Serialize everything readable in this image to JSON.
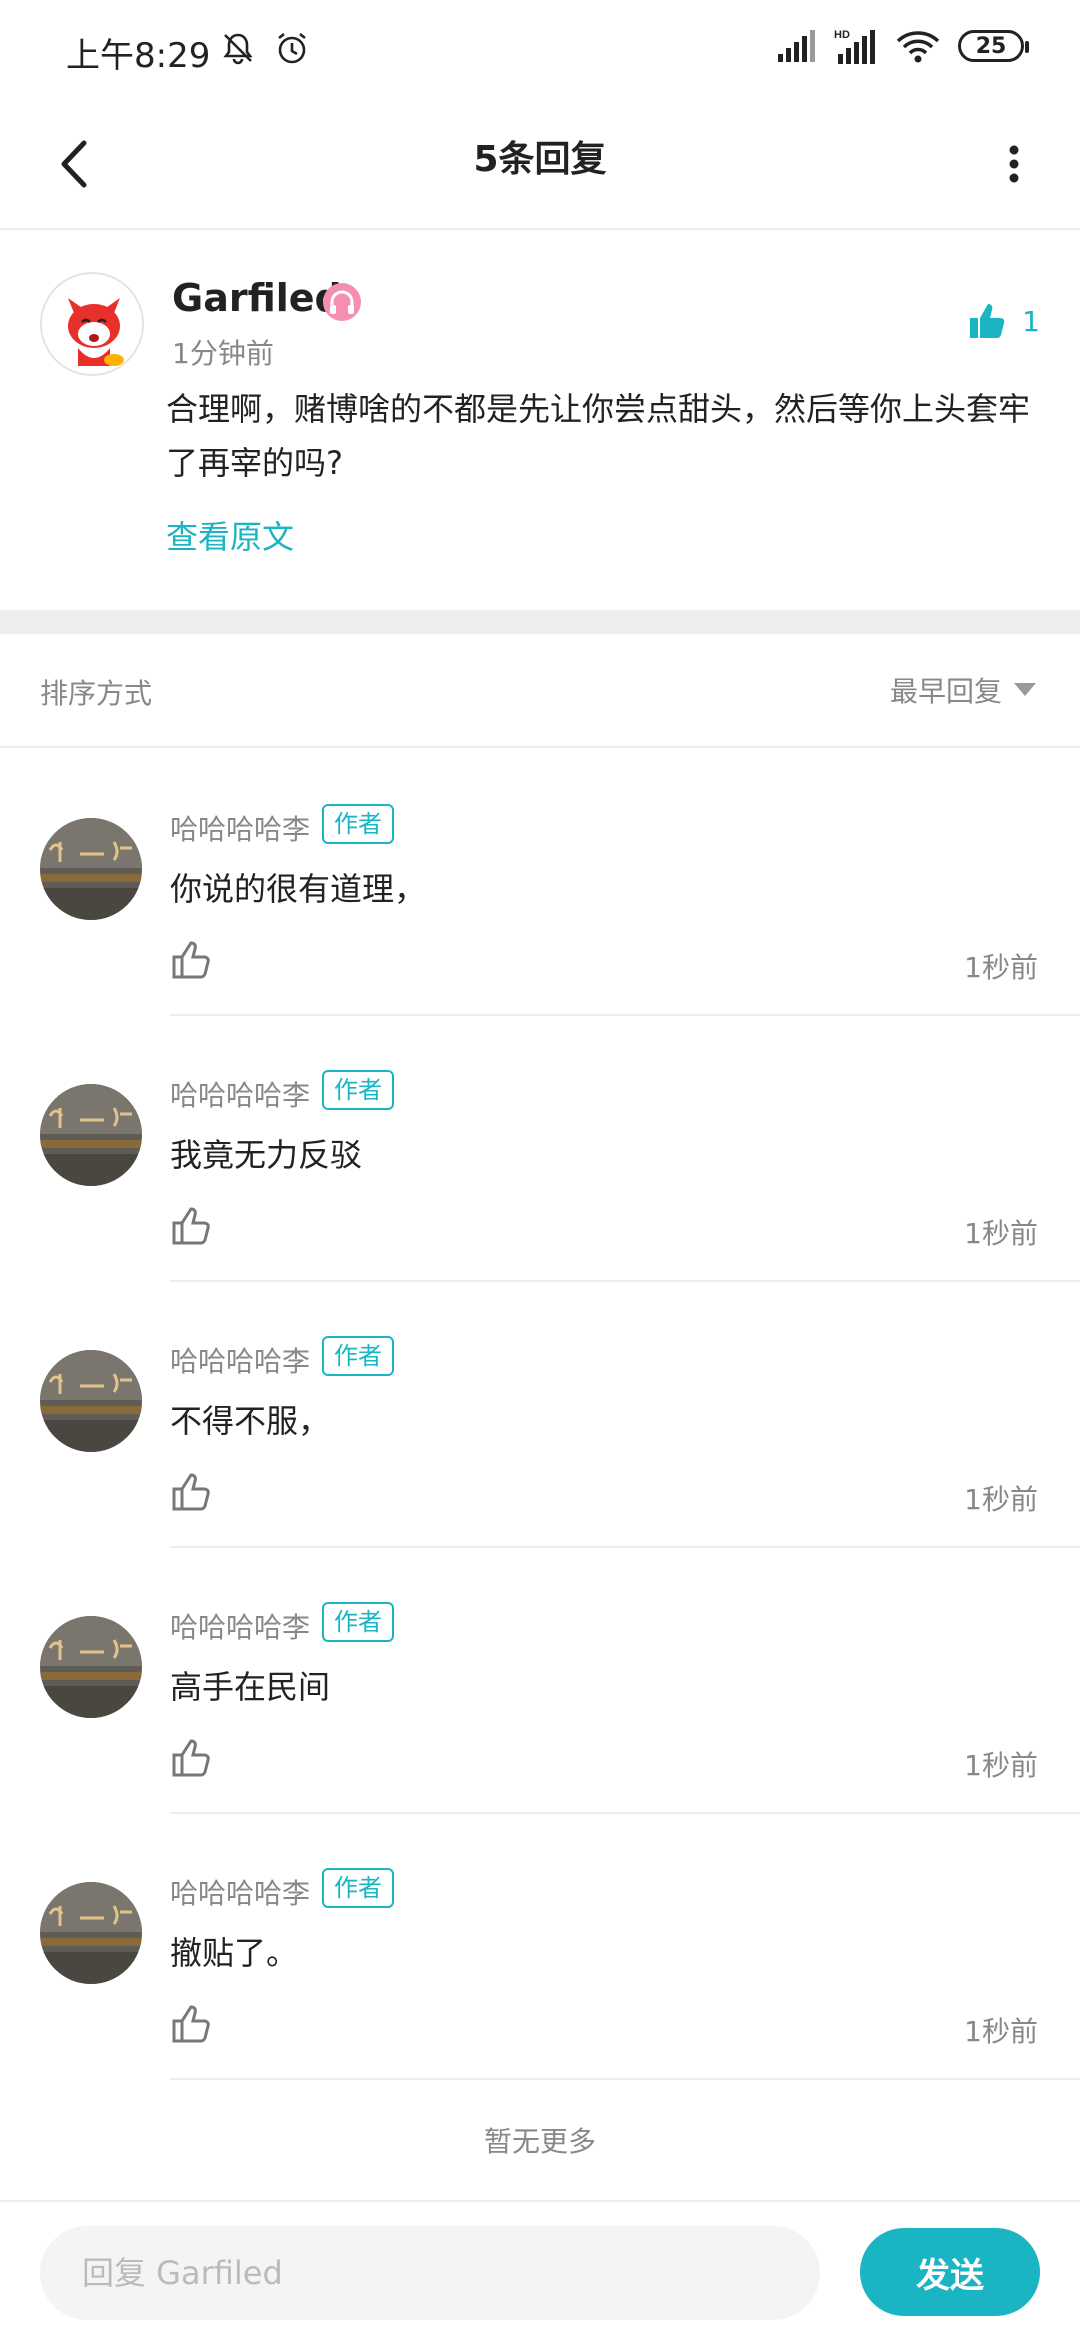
{
  "status_bar": {
    "time": "上午8:29",
    "battery": "25",
    "icons": [
      "bell-muted-icon",
      "alarm-icon",
      "signal-icon",
      "hd-signal-icon",
      "wifi-icon",
      "battery-icon"
    ]
  },
  "header": {
    "title": "5条回复",
    "back_icon": "chevron-left-icon",
    "more_icon": "more-vertical-icon"
  },
  "original": {
    "author": "Garfiled",
    "time": "1分钟前",
    "text": "合理啊，赌博啥的不都是先让你尝点甜头，然后等你上头套牢了再宰的吗?",
    "view_original": "查看原文",
    "like_count": "1",
    "colors": {
      "accent": "#1ab4c2",
      "badge": "#f48fb1"
    }
  },
  "sort": {
    "label": "排序方式",
    "value": "最早回复"
  },
  "replies": [
    {
      "author": "哈哈哈哈李",
      "tag": "作者",
      "text": "你说的很有道理，",
      "time": "1秒前"
    },
    {
      "author": "哈哈哈哈李",
      "tag": "作者",
      "text": "我竟无力反驳",
      "time": "1秒前"
    },
    {
      "author": "哈哈哈哈李",
      "tag": "作者",
      "text": "不得不服，",
      "time": "1秒前"
    },
    {
      "author": "哈哈哈哈李",
      "tag": "作者",
      "text": "高手在民间",
      "time": "1秒前"
    },
    {
      "author": "哈哈哈哈李",
      "tag": "作者",
      "text": "撤贴了。",
      "time": "1秒前"
    }
  ],
  "footer": {
    "no_more": "暂无更多",
    "input_placeholder": "回复 Garfiled",
    "send_label": "发送"
  }
}
